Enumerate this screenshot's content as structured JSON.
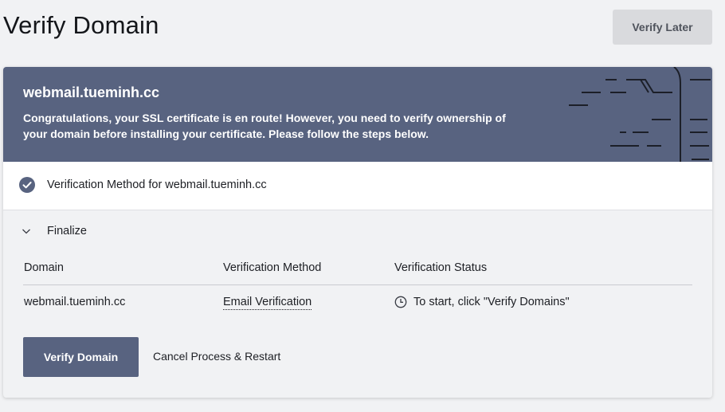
{
  "page": {
    "title": "Verify Domain",
    "verify_later_label": "Verify Later"
  },
  "banner": {
    "domain": "webmail.tueminh.cc",
    "message": "Congratulations, your SSL certificate is en route! However, you need to verify ownership of your domain before installing your certificate. Please follow the steps below."
  },
  "method_step": {
    "label": "Verification Method for webmail.tueminh.cc",
    "icon": "check-circle-icon"
  },
  "finalize": {
    "label": "Finalize",
    "icon": "chevron-down-icon",
    "table": {
      "columns": [
        "Domain",
        "Verification Method",
        "Verification Status"
      ],
      "rows": [
        {
          "domain": "webmail.tueminh.cc",
          "method": "Email Verification",
          "status": "To start, click \"Verify Domains\"",
          "status_icon": "clock-icon"
        }
      ]
    },
    "verify_button_label": "Verify Domain",
    "cancel_label": "Cancel Process & Restart"
  },
  "colors": {
    "accent": "#586380",
    "background": "#f1f2f4",
    "secondary_button": "#d9dadd"
  }
}
